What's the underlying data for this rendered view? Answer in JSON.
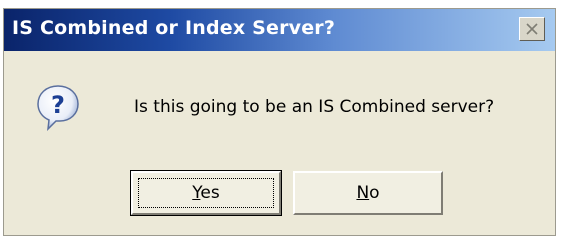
{
  "dialog": {
    "title": "IS Combined or Index Server?",
    "close_icon": "close-icon",
    "icon": "question-icon",
    "message": "Is this going to be an IS Combined server?"
  },
  "buttons": {
    "yes": {
      "label_mnemonic": "Y",
      "label_rest": "es"
    },
    "no": {
      "label_mnemonic": "N",
      "label_rest": "o"
    }
  },
  "colors": {
    "titlebar_start": "#0a246a",
    "titlebar_end": "#a6caf0",
    "dialog_background": "#ece9d8",
    "icon_bubble": "#ffffff",
    "icon_glyph": "#1c3f94"
  }
}
